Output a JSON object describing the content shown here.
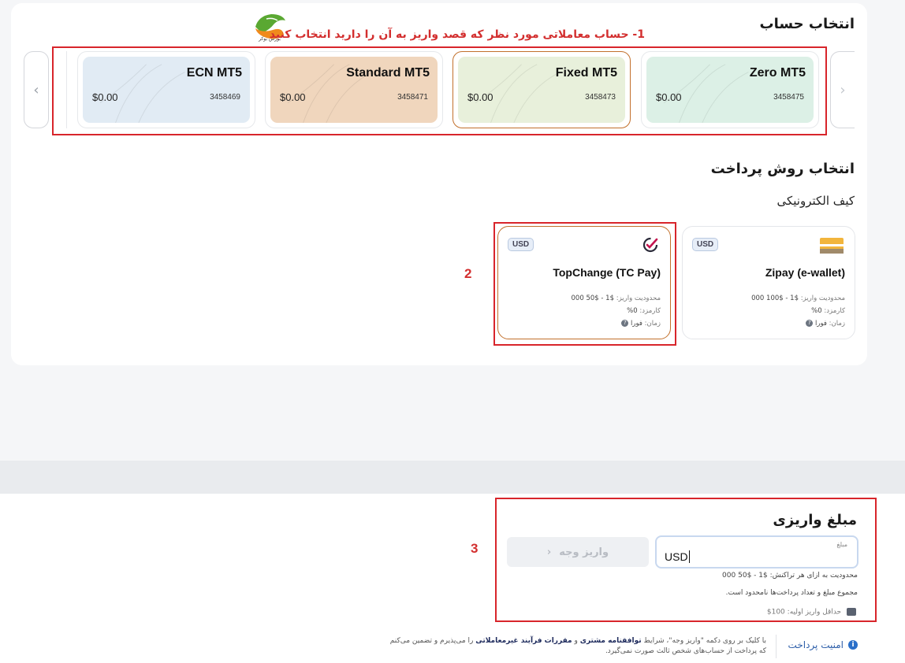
{
  "account_section": {
    "title": "انتخاب حساب",
    "annotation": "1-  حساب معاملاتی مورد نظر که قصد واریز به آن را دارید انتخاب کنید",
    "logo_text": "بورس بوکر",
    "accounts": [
      {
        "name": "ECN MT5",
        "balance": "$0.00",
        "number": "3458469",
        "color": "#e1ebf4",
        "selected": false
      },
      {
        "name": "Standard MT5",
        "balance": "$0.00",
        "number": "3458471",
        "color": "#f0d6bd",
        "selected": false
      },
      {
        "name": "Fixed MT5",
        "balance": "$0.00",
        "number": "3458473",
        "color": "#e8f0db",
        "selected": true
      },
      {
        "name": "Zero MT5",
        "balance": "$0.00",
        "number": "3458475",
        "color": "#dcf0e6",
        "selected": false
      }
    ]
  },
  "payment_section": {
    "title": "انتخاب روش پرداخت",
    "category": "کیف الکترونیکی",
    "annotation_number": "2",
    "methods": [
      {
        "name": "TopChange (TC Pay)",
        "currency": "USD",
        "limit_label": "محدودیت واریز:",
        "limit_value": "$1 - $50 000",
        "fee_label": "کارمزد:",
        "fee_value": "0%",
        "time_label": "زمان:",
        "time_value": "فورا",
        "icon": "topchange-check-icon",
        "selected": true
      },
      {
        "name": "Zipay (e-wallet)",
        "currency": "USD",
        "limit_label": "محدودیت واریز:",
        "limit_value": "$1 - $100 000",
        "fee_label": "کارمزد:",
        "fee_value": "0%",
        "time_label": "زمان:",
        "time_value": "فورا",
        "icon": "zipay-wallet-icon",
        "selected": false
      }
    ]
  },
  "amount_section": {
    "title": "مبلغ واریزی",
    "annotation_number": "3",
    "input_label": "مبلغ",
    "input_currency": "USD",
    "deposit_button": "واریز وجه",
    "limit_text": "محدودیت به ازای هر تراکنش: $1 - $50 000",
    "unlimited_text": "مجموع مبلغ و تعداد پرداخت‌ها نامحدود است.",
    "min_deposit": "حداقل واریز اولیه: 100$"
  },
  "footer": {
    "security_label": "امنیت پرداخت",
    "text_part1": "با کلیک بر روی دکمه \"واریز وجه\"، شرایط ",
    "link1": "توافقنامه مشتری",
    "text_part2": " و ",
    "link2": "مقررات فرآیند غیرمعاملاتی",
    "text_part3": " را می‌پذیرم و تضمین می‌کنم که پرداخت از حساب‌های شخص ثالث صورت نمی‌گیرد."
  },
  "colors": {
    "annotation_red": "#d32f2f",
    "selected_border": "#c2702c",
    "footer_link": "#1d2a5c"
  }
}
